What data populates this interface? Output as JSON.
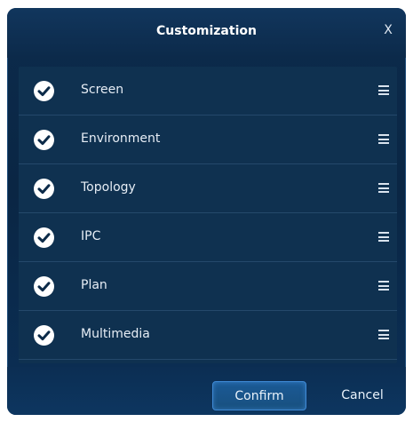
{
  "dialog": {
    "title": "Customization",
    "close_label": "X"
  },
  "items": [
    {
      "label": "Screen",
      "checked": true
    },
    {
      "label": "Environment",
      "checked": true
    },
    {
      "label": "Topology",
      "checked": true
    },
    {
      "label": "IPC",
      "checked": true
    },
    {
      "label": "Plan",
      "checked": true
    },
    {
      "label": "Multimedia",
      "checked": true
    }
  ],
  "footer": {
    "confirm_label": "Confirm",
    "cancel_label": "Cancel"
  },
  "colors": {
    "dialog_bg": "#0a2644",
    "list_bg": "#0f3150",
    "confirm_border": "#3f8ad6",
    "text": "#e6edf5"
  }
}
